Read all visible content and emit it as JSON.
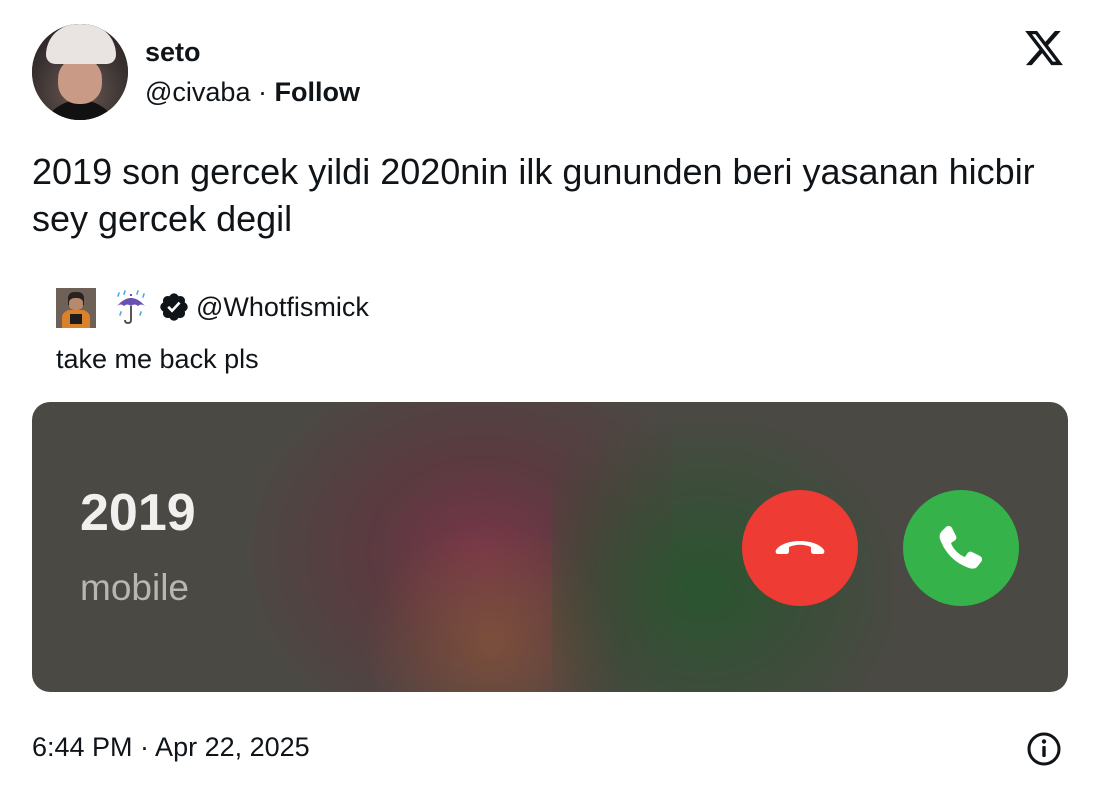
{
  "author": {
    "name": "seto",
    "handle": "@civaba",
    "separator": "·",
    "follow_label": "Follow",
    "avatar_icon": "user-avatar"
  },
  "platform": {
    "logo_icon": "x-logo-icon"
  },
  "tweet": {
    "text": "2019 son gercek yildi 2020nin ilk gununden beri yasanan hicbir sey gercek degil"
  },
  "quoted": {
    "avatar_icon": "user-avatar",
    "emoji_icon": "umbrella-with-rain-icon",
    "verified_icon": "verified-badge-icon",
    "handle": "@Whotfismick",
    "text": "take me back pls"
  },
  "media": {
    "caller": "2019",
    "caller_sub": "mobile",
    "decline_icon": "phone-hangup-icon",
    "accept_icon": "phone-accept-icon",
    "colors": {
      "decline": "#ee3b33",
      "accept": "#35b34a",
      "background": "#4b4944"
    }
  },
  "footer": {
    "timestamp": "6:44 PM · Apr 22, 2025",
    "info_icon": "info-icon"
  }
}
